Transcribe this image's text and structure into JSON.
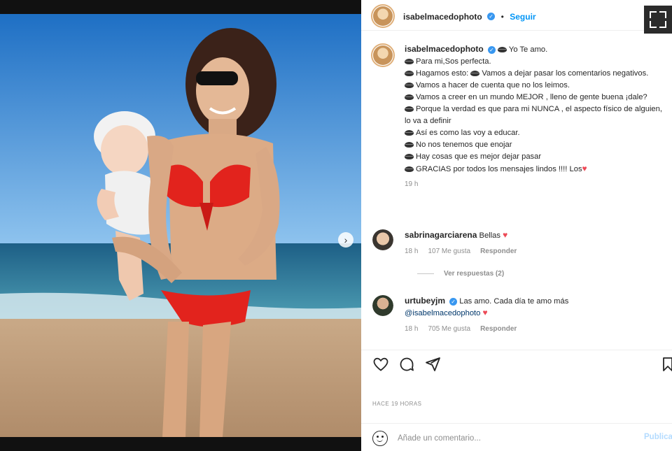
{
  "post": {
    "author": "isabelmacedophoto",
    "follow_label": "Seguir",
    "next_arrow": "›"
  },
  "caption": {
    "username": "isabelmacedophoto",
    "lines": [
      "Yo Te amo.",
      "Para mi,Sos perfecta.",
      "Hagamos esto:",
      "Vamos a dejar pasar los comentarios negativos.",
      "Vamos a hacer de cuenta que no los leimos.",
      "Vamos a creer en un mundo MEJOR , lleno de gente buena ¡dale?",
      "Porque la verdad es que para mi NUNCA , el aspecto físico de alguien, lo va a definir",
      "Así es como las voy a educar.",
      "No nos tenemos que enojar",
      "Hay cosas que es mejor dejar pasar",
      "GRACIAS por todos los mensajes lindos !!!! Los"
    ],
    "time": "19 h"
  },
  "comments": [
    {
      "username": "sabrinagarciarena",
      "text": "Bellas",
      "time": "18 h",
      "likes": "107 Me gusta",
      "reply": "Responder"
    },
    {
      "username": "urtubeyjm",
      "text": "Las amo. Cada día te amo más",
      "mention": "@isabelmacedophoto",
      "time": "18 h",
      "likes": "705 Me gusta",
      "reply": "Responder"
    }
  ],
  "view_replies": "Ver respuestas (2)",
  "posted_ago": "HACE 19 HORAS",
  "comment_box": {
    "placeholder": "Añade un comentario...",
    "publish": "Publicar"
  },
  "colors": {
    "accent": "#0095f6",
    "heart": "#ed4956",
    "verified": "#3897f0"
  },
  "icons": [
    "heart-icon",
    "comment-icon",
    "share-icon",
    "bookmark-icon",
    "emoji-icon",
    "fullscreen-icon",
    "verified-icon",
    "chevron-right-icon"
  ]
}
